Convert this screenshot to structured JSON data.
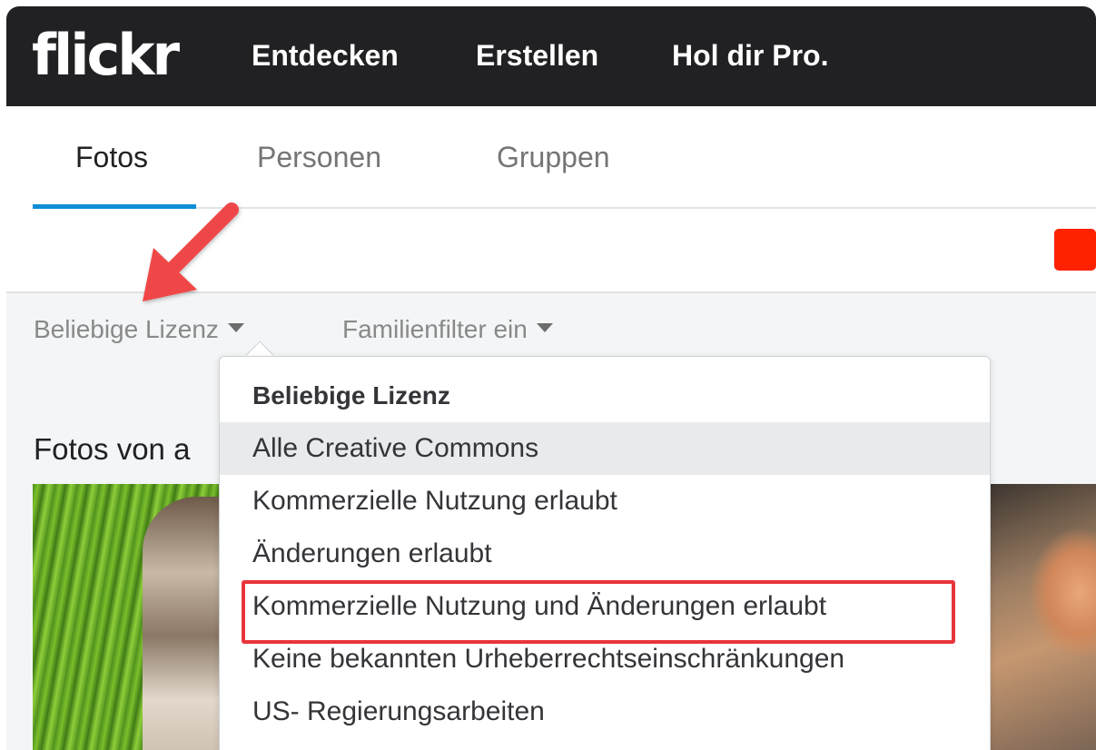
{
  "topbar": {
    "logo": "flickr",
    "nav": [
      "Entdecken",
      "Erstellen",
      "Hol dir Pro."
    ]
  },
  "tabs": [
    "Fotos",
    "Personen",
    "Gruppen"
  ],
  "active_tab": "Fotos",
  "filters": {
    "license": "Beliebige Lizenz",
    "family": "Familienfilter ein"
  },
  "section_heading": "Fotos von a",
  "dropdown": {
    "items": [
      "Beliebige Lizenz",
      "Alle Creative Commons",
      "Kommerzielle Nutzung erlaubt",
      "Änderungen erlaubt",
      "Kommerzielle Nutzung und Änderungen erlaubt",
      "Keine bekannten Urheberrechtseinschränkungen",
      "US- Regierungsarbeiten"
    ],
    "selected": "Beliebige Lizenz",
    "hovered": "Alle Creative Commons",
    "highlighted": "Kommerzielle Nutzung und Änderungen erlaubt"
  },
  "colors": {
    "topbar": "#212124",
    "tab_underline": "#0f8fd7",
    "annotation_red": "#e8343a",
    "accent_red": "#ff2200"
  },
  "icons": [
    "caret-down-icon",
    "annotation-arrow-icon"
  ]
}
